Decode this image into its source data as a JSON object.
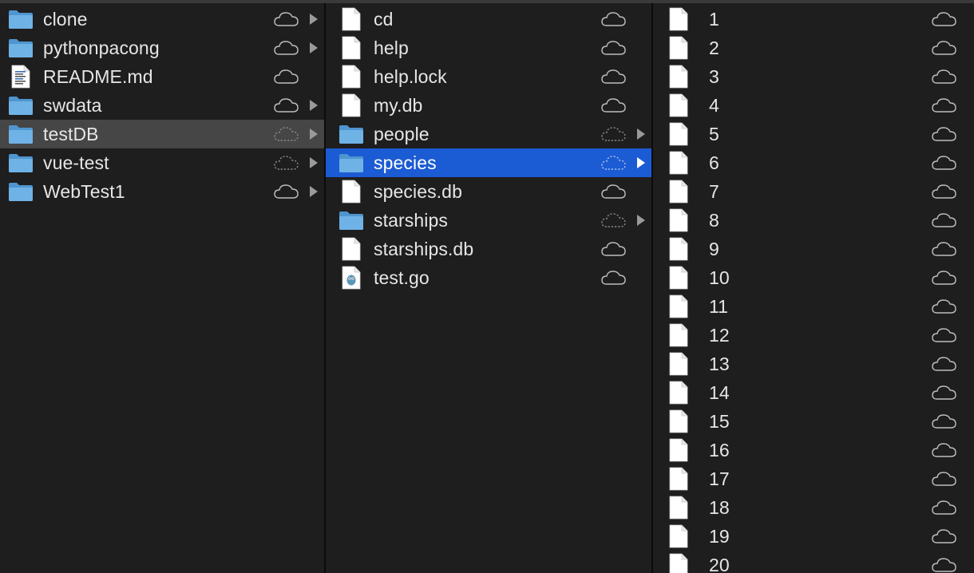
{
  "columns": [
    {
      "items": [
        {
          "name": "clone",
          "kind": "folder",
          "cloud": "solid",
          "arrow": true
        },
        {
          "name": "pythonpacong",
          "kind": "folder",
          "cloud": "solid",
          "arrow": true
        },
        {
          "name": "README.md",
          "kind": "text",
          "cloud": "solid",
          "arrow": false
        },
        {
          "name": "swdata",
          "kind": "folder",
          "cloud": "solid",
          "arrow": true
        },
        {
          "name": "testDB",
          "kind": "folder",
          "cloud": "dashed",
          "arrow": true,
          "selected": "gray"
        },
        {
          "name": "vue-test",
          "kind": "folder",
          "cloud": "dashed",
          "arrow": true
        },
        {
          "name": "WebTest1",
          "kind": "folder",
          "cloud": "solid",
          "arrow": true
        }
      ]
    },
    {
      "items": [
        {
          "name": "cd",
          "kind": "doc",
          "cloud": "solid",
          "arrow": false
        },
        {
          "name": "help",
          "kind": "doc",
          "cloud": "solid",
          "arrow": false
        },
        {
          "name": "help.lock",
          "kind": "doc",
          "cloud": "solid",
          "arrow": false
        },
        {
          "name": "my.db",
          "kind": "doc",
          "cloud": "solid",
          "arrow": false
        },
        {
          "name": "people",
          "kind": "folder",
          "cloud": "dashed",
          "arrow": true
        },
        {
          "name": "species",
          "kind": "folder",
          "cloud": "dashed",
          "arrow": true,
          "selected": "blue"
        },
        {
          "name": "species.db",
          "kind": "doc",
          "cloud": "solid",
          "arrow": false
        },
        {
          "name": "starships",
          "kind": "folder",
          "cloud": "dashed",
          "arrow": true
        },
        {
          "name": "starships.db",
          "kind": "doc",
          "cloud": "solid",
          "arrow": false
        },
        {
          "name": "test.go",
          "kind": "go",
          "cloud": "solid",
          "arrow": false
        }
      ]
    },
    {
      "items": [
        {
          "name": "1",
          "kind": "doc",
          "cloud": "solid",
          "arrow": false
        },
        {
          "name": "2",
          "kind": "doc",
          "cloud": "solid",
          "arrow": false
        },
        {
          "name": "3",
          "kind": "doc",
          "cloud": "solid",
          "arrow": false
        },
        {
          "name": "4",
          "kind": "doc",
          "cloud": "solid",
          "arrow": false
        },
        {
          "name": "5",
          "kind": "doc",
          "cloud": "solid",
          "arrow": false
        },
        {
          "name": "6",
          "kind": "doc",
          "cloud": "solid",
          "arrow": false
        },
        {
          "name": "7",
          "kind": "doc",
          "cloud": "solid",
          "arrow": false
        },
        {
          "name": "8",
          "kind": "doc",
          "cloud": "solid",
          "arrow": false
        },
        {
          "name": "9",
          "kind": "doc",
          "cloud": "solid",
          "arrow": false
        },
        {
          "name": "10",
          "kind": "doc",
          "cloud": "solid",
          "arrow": false
        },
        {
          "name": "11",
          "kind": "doc",
          "cloud": "solid",
          "arrow": false
        },
        {
          "name": "12",
          "kind": "doc",
          "cloud": "solid",
          "arrow": false
        },
        {
          "name": "13",
          "kind": "doc",
          "cloud": "solid",
          "arrow": false
        },
        {
          "name": "14",
          "kind": "doc",
          "cloud": "solid",
          "arrow": false
        },
        {
          "name": "15",
          "kind": "doc",
          "cloud": "solid",
          "arrow": false
        },
        {
          "name": "16",
          "kind": "doc",
          "cloud": "solid",
          "arrow": false
        },
        {
          "name": "17",
          "kind": "doc",
          "cloud": "solid",
          "arrow": false
        },
        {
          "name": "18",
          "kind": "doc",
          "cloud": "solid",
          "arrow": false
        },
        {
          "name": "19",
          "kind": "doc",
          "cloud": "solid",
          "arrow": false
        },
        {
          "name": "20",
          "kind": "doc",
          "cloud": "solid",
          "arrow": false
        }
      ]
    }
  ],
  "colors": {
    "background": "#1e1e1e",
    "selection_blue": "#1b5bd3",
    "selection_gray": "#464646",
    "folder_blue": "#6fb2e6",
    "folder_blue_dark": "#4f95cf",
    "text": "#e6e6e6",
    "cloud": "#bdbdbd",
    "cloud_dashed": "#8a8a8a"
  }
}
